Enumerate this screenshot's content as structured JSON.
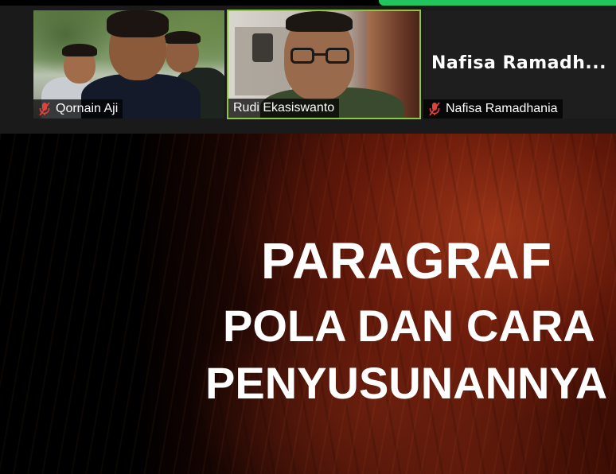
{
  "meeting": {
    "indicator_color": "#21c45d",
    "active_speaker_border": "#8dc63f"
  },
  "participants": [
    {
      "name": "Qornain Aji",
      "mic": "mic-muted-icon",
      "video": true
    },
    {
      "name": "Rudi Ekasiswanto",
      "mic": "none",
      "video": true,
      "active_speaker": true
    },
    {
      "name": "Nafisa Ramadhania",
      "display_name": "Nafisa  Ramadh...",
      "mic": "mic-muted-icon",
      "video": false
    }
  ],
  "slide": {
    "title": "PARAGRAF",
    "line1": "POLA DAN CARA",
    "line2": "PENYUSUNANNYA"
  }
}
